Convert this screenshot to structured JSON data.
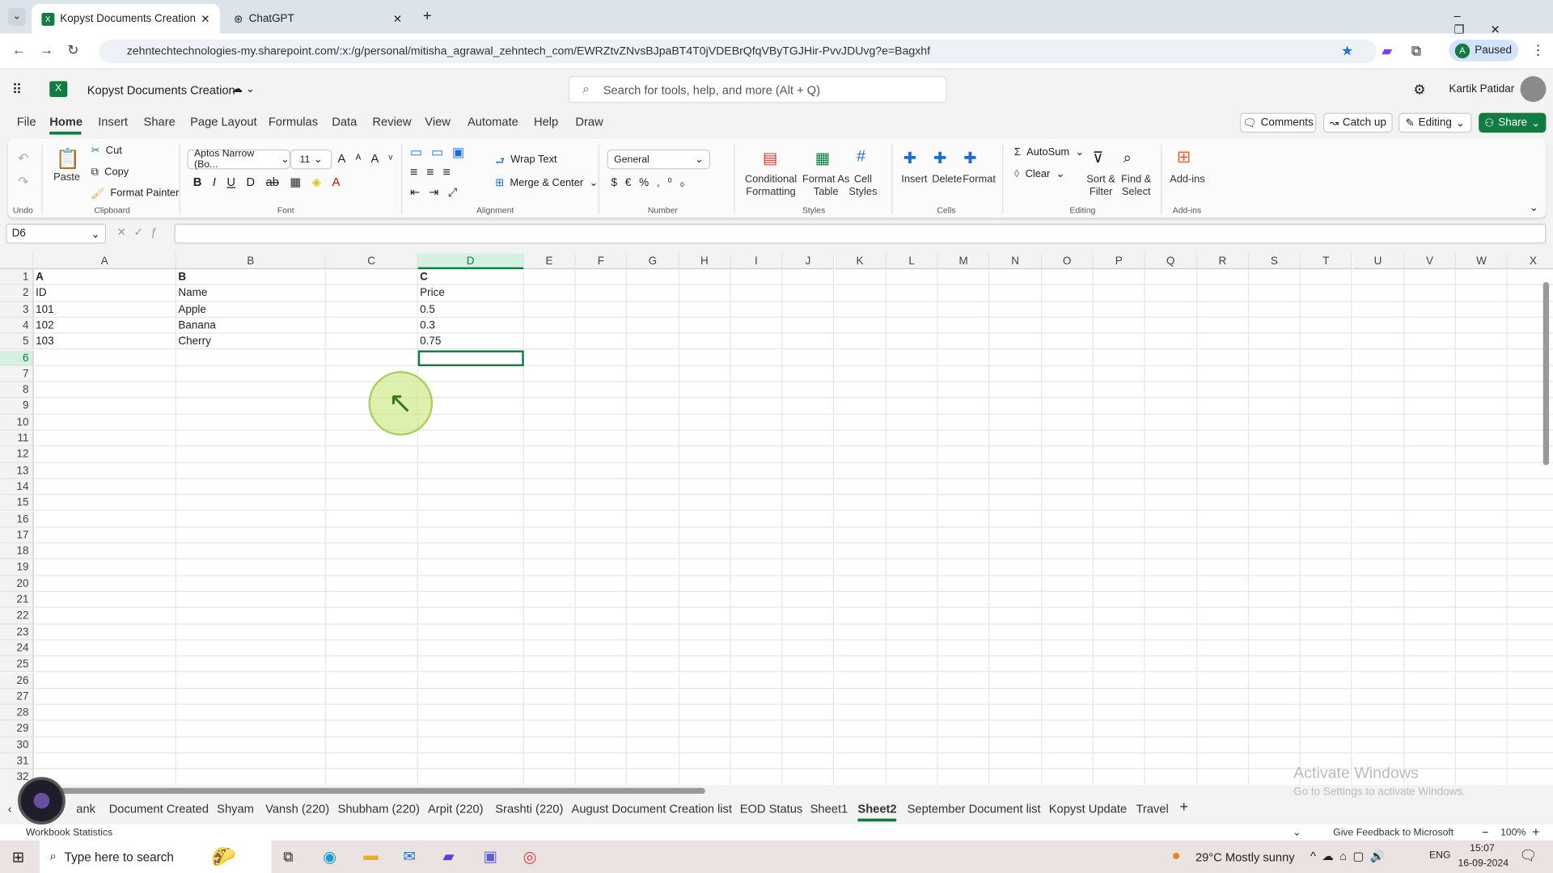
{
  "browser": {
    "tabs": [
      {
        "title": "Kopyst Documents Creation.xlsx",
        "active": true
      },
      {
        "title": "ChatGPT",
        "active": false
      }
    ],
    "url": "zehntechtechnologies-my.sharepoint.com/:x:/g/personal/mitisha_agrawal_zehntech_com/EWRZtvZNvsBJpaBT4T0jVDEBrQfqVByTGJHir-PvvJDUvg?e=Bagxhf",
    "profile_initial": "A",
    "profile_status": "Paused"
  },
  "app": {
    "doc_title": "Kopyst Documents Creation",
    "search_placeholder": "Search for tools, help, and more (Alt + Q)",
    "user": "Kartik Patidar",
    "comments": "Comments",
    "catch_up": "Catch up",
    "editing": "Editing",
    "share": "Share"
  },
  "menu": [
    "File",
    "Home",
    "Insert",
    "Share",
    "Page Layout",
    "Formulas",
    "Data",
    "Review",
    "View",
    "Automate",
    "Help",
    "Draw"
  ],
  "ribbon": {
    "undo": "Undo",
    "paste": "Paste",
    "cut": "Cut",
    "copy": "Copy",
    "format_painter": "Format Painter",
    "clipboard": "Clipboard",
    "font_name": "Aptos Narrow (Bo...",
    "font_size": "11",
    "font": "Font",
    "wrap_text": "Wrap Text",
    "merge_center": "Merge & Center",
    "alignment": "Alignment",
    "number_format": "General",
    "number": "Number",
    "conditional": [
      "Conditional",
      "Formatting"
    ],
    "format_table": [
      "Format As",
      "Table"
    ],
    "cell_styles": [
      "Cell",
      "Styles"
    ],
    "styles": "Styles",
    "insert": "Insert",
    "delete": "Delete",
    "format": "Format",
    "cells": "Cells",
    "autosum": "AutoSum",
    "clear": "Clear",
    "sort": [
      "Sort &",
      "Filter"
    ],
    "find": [
      "Find &",
      "Select"
    ],
    "editing": "Editing",
    "addins": "Add-ins",
    "addins_group": "Add-ins"
  },
  "formula_bar": {
    "name_box": "D6",
    "formula": ""
  },
  "sheet": {
    "columns": [
      "A",
      "B",
      "C",
      "D",
      "E",
      "F",
      "G",
      "H",
      "I",
      "J",
      "K",
      "L",
      "M",
      "N",
      "O",
      "P",
      "Q",
      "R",
      "S",
      "T",
      "U",
      "V",
      "W",
      "X"
    ],
    "row_count": 32,
    "selected_cell": "D6",
    "cells": [
      [
        "A",
        "B",
        "",
        "C"
      ],
      [
        "ID",
        "Name",
        "",
        "Price"
      ],
      [
        "101",
        "Apple",
        "",
        "0.5"
      ],
      [
        "102",
        "Banana",
        "",
        "0.3"
      ],
      [
        "103",
        "Cherry",
        "",
        "0.75"
      ]
    ]
  },
  "sheet_tabs": [
    "ank",
    "Document Created",
    "Shyam",
    "Vansh (220)",
    "Shubham (220)",
    "Arpit (220)",
    "Srashti (220)",
    "August Document Creation list",
    "EOD Status",
    "Sheet1",
    "Sheet2",
    "September Document list",
    "Kopyst Update",
    "Travel"
  ],
  "active_sheet": "Sheet2",
  "watermark": {
    "line1": "Activate Windows",
    "line2": "Go to Settings to activate Windows."
  },
  "status": {
    "left": "Workbook Statistics",
    "feedback": "Give Feedback to Microsoft",
    "zoom": "100%"
  },
  "taskbar": {
    "search": "Type here to search",
    "weather": "29°C  Mostly sunny",
    "lang": "ENG",
    "time": "15:07",
    "date": "16-09-2024"
  },
  "colors": {
    "excel_green": "#107c41",
    "selection": "#107c41",
    "accent_blue": "#0f6cbd"
  }
}
